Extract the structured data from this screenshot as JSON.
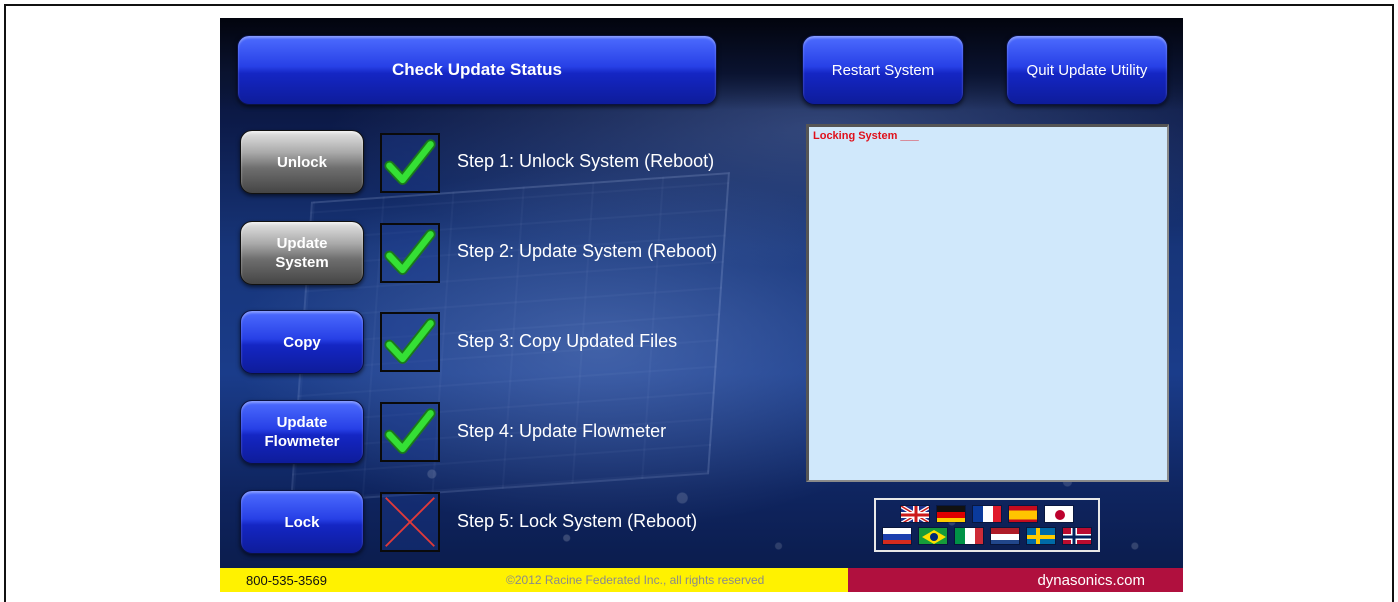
{
  "header": {
    "check_status_label": "Check Update Status",
    "restart_label": "Restart System",
    "quit_label": "Quit Update Utility"
  },
  "steps": [
    {
      "button_label": "Unlock",
      "button_style": "gray",
      "status": "done",
      "description": "Step 1: Unlock System (Reboot)"
    },
    {
      "button_label": "Update\nSystem",
      "button_style": "gray",
      "status": "done",
      "description": "Step 2: Update System (Reboot)"
    },
    {
      "button_label": "Copy",
      "button_style": "blue",
      "status": "done",
      "description": "Step 3: Copy Updated Files"
    },
    {
      "button_label": "Update\nFlowmeter",
      "button_style": "blue",
      "status": "done",
      "description": "Step 4: Update Flowmeter"
    },
    {
      "button_label": "Lock",
      "button_style": "blue",
      "status": "failed",
      "description": "Step 5: Lock System (Reboot)"
    }
  ],
  "log": {
    "lines": [
      "Locking System ___"
    ]
  },
  "languages": {
    "row1": [
      "english-flag",
      "german-flag",
      "french-flag",
      "spanish-flag",
      "japanese-flag"
    ],
    "row2": [
      "russian-flag",
      "brazilian-flag",
      "italian-flag",
      "dutch-flag",
      "swedish-flag",
      "norwegian-flag"
    ]
  },
  "footer": {
    "phone": "800-535-3569",
    "copyright": "©2012 Racine Federated Inc., all rights reserved",
    "website": "dynasonics.com"
  },
  "colors": {
    "check_green": "#2ecc2e",
    "fail_red": "#e03a3a",
    "footer_yellow": "#fff200",
    "footer_crimson": "#b0103e",
    "log_bg": "#d0e8fb"
  }
}
